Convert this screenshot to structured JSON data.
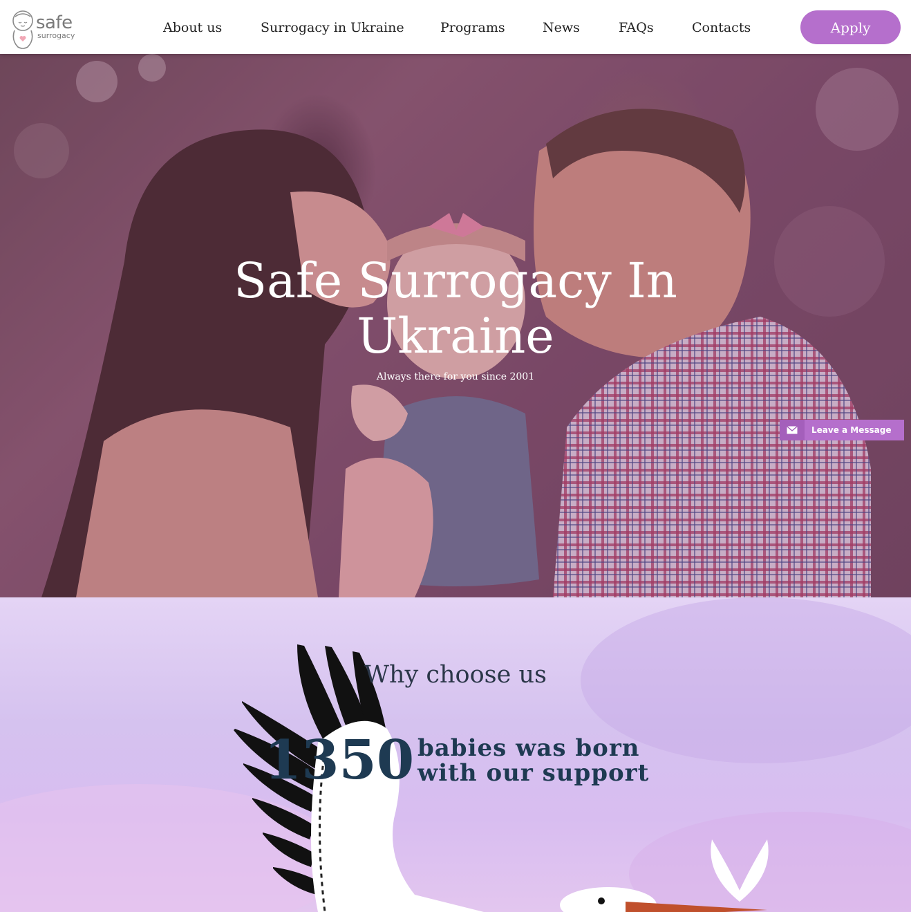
{
  "header": {
    "logo_main": "safe",
    "logo_sub": "surrogacy",
    "nav": [
      {
        "label": "About us",
        "id": "about-us"
      },
      {
        "label": "Surrogacy in Ukraine",
        "id": "surrogacy-in-ukraine"
      },
      {
        "label": "Programs",
        "id": "programs"
      },
      {
        "label": "News",
        "id": "news"
      },
      {
        "label": "FAQs",
        "id": "faqs"
      },
      {
        "label": "Contacts",
        "id": "contacts"
      }
    ],
    "apply_label": "Apply"
  },
  "hero": {
    "title_line1": "Safe Surrogacy In",
    "title_line2": "Ukraine",
    "subtitle": "Always there for you since 2001"
  },
  "widget": {
    "leave_message": "Leave a Message",
    "icon": "envelope-icon"
  },
  "why": {
    "title": "Why choose us",
    "stat_number": "1350",
    "stat_line1": "babies was born",
    "stat_line2": "with our support"
  },
  "colors": {
    "accent": "#b56fcc",
    "stat_text": "#1e3a52",
    "section_bg": "#d8c6f0"
  }
}
